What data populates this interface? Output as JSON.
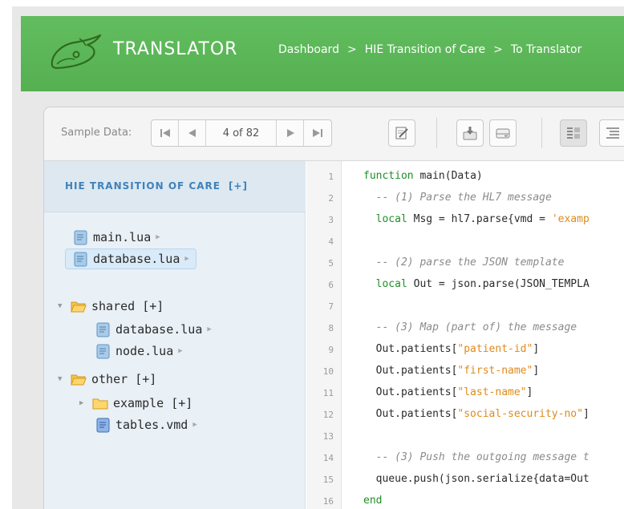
{
  "header": {
    "app_title": "TRANSLATOR",
    "breadcrumb": [
      "Dashboard",
      "HIE Transition of Care",
      "To Translator"
    ],
    "separator": ">"
  },
  "toolbar": {
    "sample_label": "Sample Data:",
    "sample_position": "4 of 82",
    "buttons": [
      "first-icon",
      "previous-icon",
      "next-icon",
      "last-icon",
      "edit-icon",
      "import-icon",
      "drive-icon",
      "annotate-icon",
      "outline-icon"
    ]
  },
  "sidebar": {
    "project_title": "HIE TRANSITION OF CARE",
    "project_add": "[+]",
    "root_files": [
      {
        "name": "main.lua"
      },
      {
        "name": "database.lua",
        "selected": true
      }
    ],
    "folders": [
      {
        "name": "shared",
        "add": "[+]",
        "files": [
          {
            "name": "database.lua"
          },
          {
            "name": "node.lua"
          }
        ]
      },
      {
        "name": "other",
        "add": "[+]",
        "subfolder": {
          "name": "example",
          "add": "[+]"
        },
        "files": [
          {
            "name": "tables.vmd"
          }
        ]
      }
    ]
  },
  "editor": {
    "line_numbers": [
      "1",
      "2",
      "3",
      "4",
      "5",
      "6",
      "7",
      "8",
      "9",
      "10",
      "11",
      "12",
      "13",
      "14",
      "15",
      "16"
    ],
    "lines": [
      {
        "kw1": "function",
        "t1": " main(Data)"
      },
      {
        "cm": "  -- (1) Parse the HL7 message"
      },
      {
        "kw1": "  local",
        "t1": " Msg = hl7.parse{vmd = ",
        "st": "'examp"
      },
      {},
      {
        "cm": "  -- (2) parse the JSON template"
      },
      {
        "kw1": "  local",
        "t1": " Out = json.parse(JSON_TEMPLA"
      },
      {},
      {
        "cm": "  -- (3) Map (part of) the message"
      },
      {
        "t1": "  Out.patients[",
        "st": "\"patient-id\"",
        "t2": "]"
      },
      {
        "t1": "  Out.patients[",
        "st": "\"first-name\"",
        "t2": "]"
      },
      {
        "t1": "  Out.patients[",
        "st": "\"last-name\"",
        "t2": "]"
      },
      {
        "t1": "  Out.patients[",
        "st": "\"social-security-no\"",
        "t2": "]"
      },
      {},
      {
        "cm": "  -- (3) Push the outgoing message t"
      },
      {
        "t1": "  queue.push(json.serialize{data=Out"
      },
      {
        "kw1": "end"
      }
    ]
  },
  "colors": {
    "header_green": "#5bb75b",
    "keyword_green": "#1f8f2a",
    "string_orange": "#e08a1c",
    "project_blue": "#3f82ba"
  }
}
